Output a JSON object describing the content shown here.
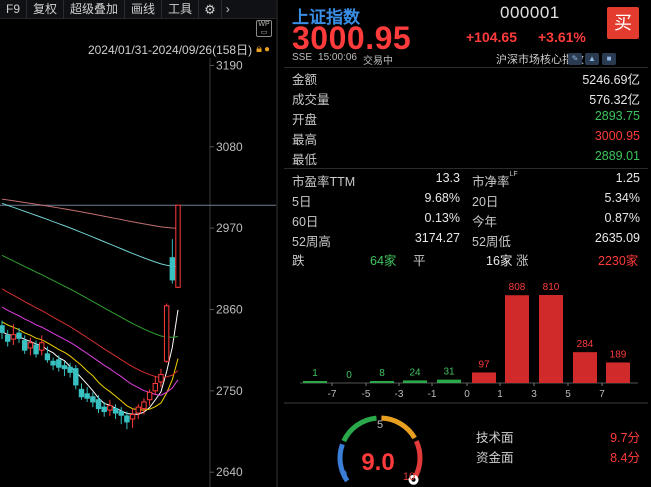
{
  "toolbar": {
    "items": [
      "F9",
      "复权",
      "超级叠加",
      "画线",
      "工具"
    ],
    "gear_icon": "gear-icon",
    "more_icon": "chevron-right-icon"
  },
  "chart_header": {
    "date_range": "2024/01/31-2024/09/26(158日)",
    "lock_icon": "lock-icon",
    "wp_label": "WP"
  },
  "chart_data": {
    "type": "candlestick",
    "y_ticks": [
      "3190",
      "3080",
      "2970",
      "2860",
      "2750",
      "2640"
    ],
    "ylim": [
      2620,
      3200
    ],
    "reference_line": 3000.95,
    "candles": [
      {
        "o": 2838,
        "c": 2829,
        "h": 2845,
        "l": 2820
      },
      {
        "o": 2825,
        "c": 2817,
        "h": 2832,
        "l": 2810
      },
      {
        "o": 2820,
        "c": 2826,
        "h": 2840,
        "l": 2812
      },
      {
        "o": 2828,
        "c": 2821,
        "h": 2835,
        "l": 2815
      },
      {
        "o": 2818,
        "c": 2805,
        "h": 2825,
        "l": 2800
      },
      {
        "o": 2808,
        "c": 2815,
        "h": 2822,
        "l": 2798
      },
      {
        "o": 2812,
        "c": 2800,
        "h": 2818,
        "l": 2795
      },
      {
        "o": 2805,
        "c": 2815,
        "h": 2825,
        "l": 2798
      },
      {
        "o": 2800,
        "c": 2792,
        "h": 2810,
        "l": 2788
      },
      {
        "o": 2790,
        "c": 2785,
        "h": 2795,
        "l": 2778
      },
      {
        "o": 2792,
        "c": 2782,
        "h": 2798,
        "l": 2776
      },
      {
        "o": 2784,
        "c": 2780,
        "h": 2790,
        "l": 2770
      },
      {
        "o": 2782,
        "c": 2775,
        "h": 2788,
        "l": 2768
      },
      {
        "o": 2780,
        "c": 2758,
        "h": 2785,
        "l": 2752
      },
      {
        "o": 2752,
        "c": 2742,
        "h": 2760,
        "l": 2738
      },
      {
        "o": 2746,
        "c": 2740,
        "h": 2755,
        "l": 2735
      },
      {
        "o": 2742,
        "c": 2735,
        "h": 2748,
        "l": 2728
      },
      {
        "o": 2738,
        "c": 2726,
        "h": 2744,
        "l": 2720
      },
      {
        "o": 2728,
        "c": 2722,
        "h": 2735,
        "l": 2715
      },
      {
        "o": 2724,
        "c": 2730,
        "h": 2738,
        "l": 2716
      },
      {
        "o": 2726,
        "c": 2720,
        "h": 2732,
        "l": 2712
      },
      {
        "o": 2722,
        "c": 2717,
        "h": 2728,
        "l": 2705
      },
      {
        "o": 2716,
        "c": 2708,
        "h": 2722,
        "l": 2698
      },
      {
        "o": 2712,
        "c": 2718,
        "h": 2726,
        "l": 2700
      },
      {
        "o": 2720,
        "c": 2728,
        "h": 2732,
        "l": 2712
      },
      {
        "o": 2726,
        "c": 2735,
        "h": 2740,
        "l": 2718
      },
      {
        "o": 2738,
        "c": 2748,
        "h": 2752,
        "l": 2730
      },
      {
        "o": 2750,
        "c": 2760,
        "h": 2770,
        "l": 2745
      },
      {
        "o": 2762,
        "c": 2772,
        "h": 2780,
        "l": 2755
      },
      {
        "o": 2790,
        "c": 2865,
        "h": 2868,
        "l": 2788
      },
      {
        "o": 2930,
        "c": 2900,
        "h": 2955,
        "l": 2895
      },
      {
        "o": 2890,
        "c": 3001,
        "h": 3001,
        "l": 2889
      }
    ]
  },
  "quote": {
    "name": "上证指数",
    "code": "000001",
    "buy_label": "买",
    "price": "3000.95",
    "change": "+104.65",
    "change_pct": "+3.61%",
    "exchange": "SSE",
    "time": "15:00:06",
    "status": "交易中",
    "core_index": "沪深市场核心指数"
  },
  "stats": [
    {
      "label": "金额",
      "value": "5246.69亿",
      "color": "white"
    },
    {
      "label": "成交量",
      "value": "576.32亿",
      "color": "white"
    },
    {
      "label": "开盘",
      "value": "2893.75",
      "color": "green"
    },
    {
      "label": "最高",
      "value": "3000.95",
      "color": "red"
    },
    {
      "label": "最低",
      "value": "2889.01",
      "color": "green"
    }
  ],
  "ratios": {
    "pe_label": "市盈率TTM",
    "pe": "13.3",
    "pb_label": "市净率",
    "pb_sup": "LF",
    "pb": "1.25",
    "d5_label": "5日",
    "d5": "9.68%",
    "d20_label": "20日",
    "d20": "5.34%",
    "d60_label": "60日",
    "d60": "0.13%",
    "ytd_label": "今年",
    "ytd": "0.87%",
    "w52h_label": "52周高",
    "w52h": "3174.27",
    "w52l_label": "52周低",
    "w52l": "2635.09"
  },
  "distribution": {
    "down_label": "跌",
    "down": "64家",
    "flat_label": "平",
    "flat": "16家",
    "up_label": "涨",
    "up": "2230家",
    "histogram": {
      "x_ticks": [
        "-7",
        "-5",
        "-3",
        "-1",
        "0",
        "1",
        "3",
        "5",
        "7"
      ],
      "values": [
        1,
        0,
        8,
        24,
        31,
        97,
        808,
        810,
        284,
        189
      ],
      "labels": [
        "1",
        "0",
        "8",
        "24",
        "31",
        "97",
        "808",
        "810",
        "284",
        "189"
      ]
    }
  },
  "gauge": {
    "value": "9.0",
    "min": "0",
    "mid": "5",
    "max": "10",
    "score": 9.0
  },
  "tech": {
    "tech_label": "技术面",
    "tech_value": "9.7分",
    "fund_label": "资金面",
    "fund_value": "8.4分"
  },
  "colors": {
    "up": "#ff3b3b",
    "down": "#3ec35e",
    "accent": "#3a8ee6"
  }
}
